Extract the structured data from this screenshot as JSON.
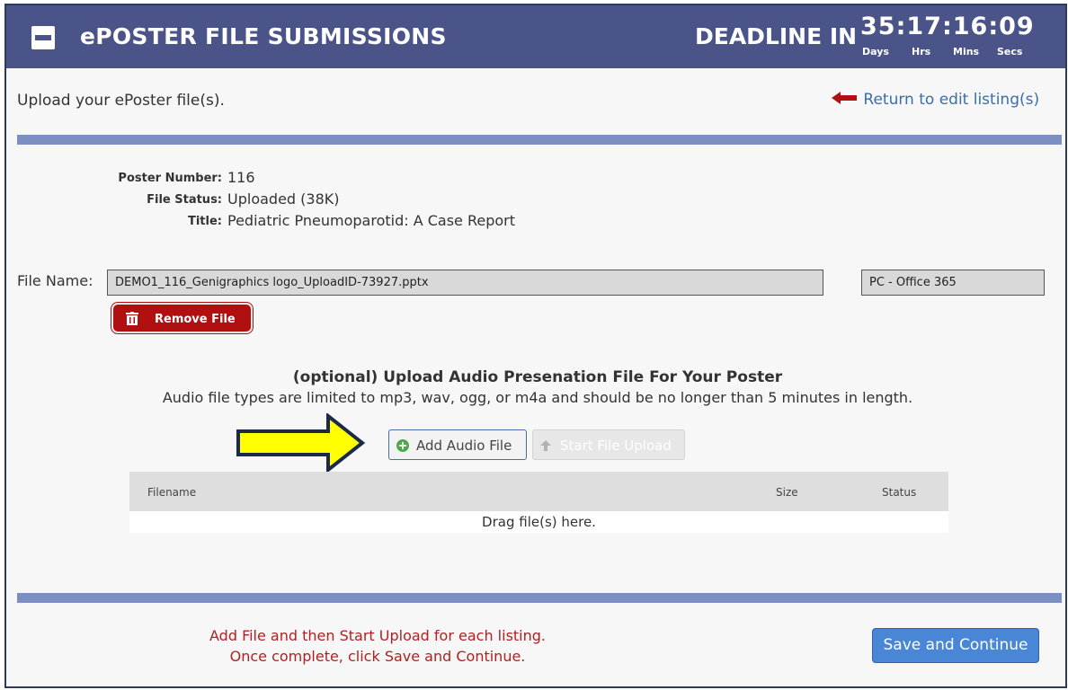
{
  "header": {
    "title": "ePOSTER FILE SUBMISSIONS",
    "deadline_label": "DEADLINE IN",
    "countdown": "35:17:16:09",
    "units": {
      "days": "Days",
      "hrs": "Hrs",
      "mins": "Mins",
      "secs": "Secs"
    }
  },
  "upload_heading": "Upload your ePoster file(s).",
  "return_link": "Return to edit listing(s)",
  "poster": {
    "number_label": "Poster Number:",
    "number_value": "116",
    "status_label": "File Status:",
    "status_value": "Uploaded (38K)",
    "title_label": "Title:",
    "title_value": "Pediatric Pneumoparotid: A Case Report"
  },
  "file": {
    "label": "File Name:",
    "name": "DEMO1_116_Genigraphics logo_UploadID-73927.pptx",
    "platform": "PC - Office 365",
    "remove_label": "Remove File"
  },
  "audio": {
    "title": "(optional) Upload Audio Presenation File For Your Poster",
    "description": "Audio file types are limited to mp3, wav, ogg, or m4a and should be no longer than 5 minutes in length.",
    "add_label": "Add Audio File",
    "start_label": "Start File Upload",
    "table": {
      "col_filename": "Filename",
      "col_size": "Size",
      "col_status": "Status",
      "drop_text": "Drag file(s) here."
    }
  },
  "footer": {
    "instruction_1": "Add File and then Start Upload for each listing.",
    "instruction_2": "Once complete, click Save and Continue.",
    "save_label": "Save and Continue"
  },
  "colors": {
    "header_bg": "#4b5488",
    "accent_bar": "#7b8fc2",
    "remove_red": "#b01010",
    "save_blue": "#4a86d6",
    "instruction_red": "#b22020",
    "arrow_yellow": "#ffff00"
  }
}
